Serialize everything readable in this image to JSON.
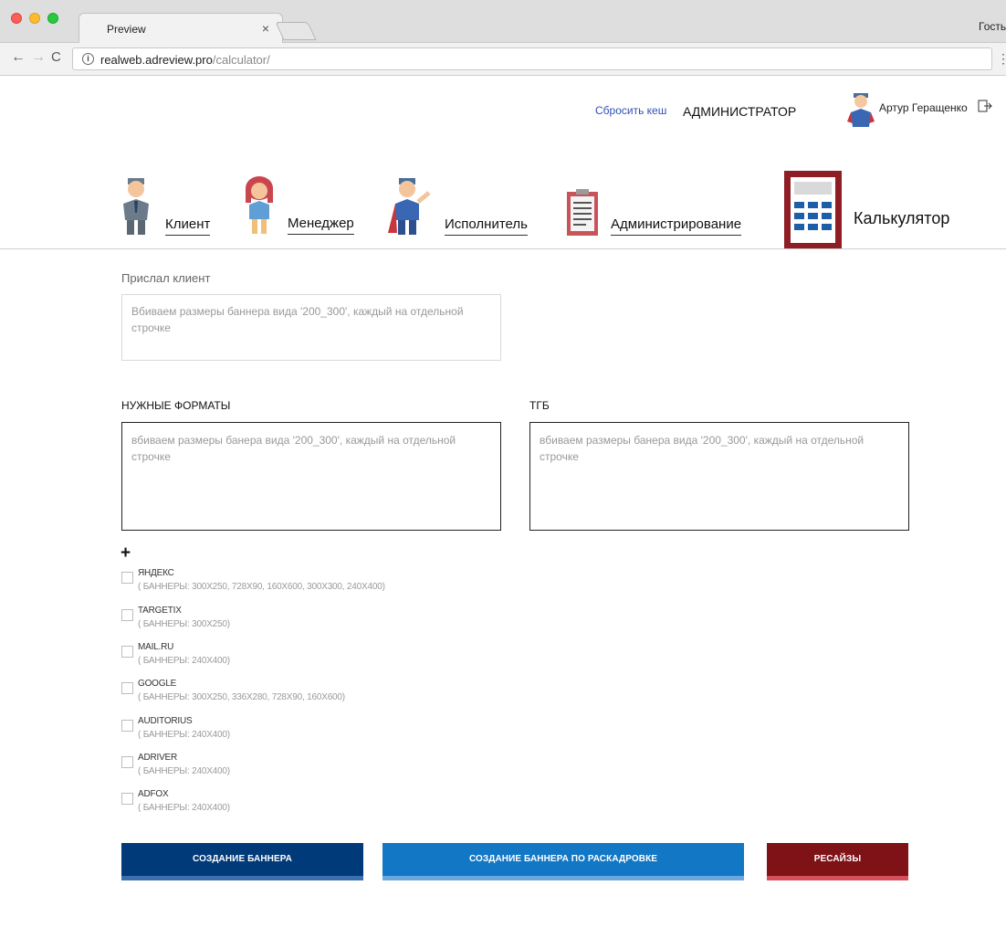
{
  "browser": {
    "tab_title": "Preview",
    "tab_close": "×",
    "guest_label": "Гость",
    "url_host": "realweb.adreview.pro",
    "url_path": "/calculator/",
    "back_glyph": "←",
    "forward_glyph": "→",
    "reload_glyph": "C",
    "menu_glyph": "⋮",
    "info_glyph": "i"
  },
  "header": {
    "reset_cache": "Сбросить кеш",
    "role": "АДМИНИСТРАТОР",
    "user_name": "Артур Геращенко"
  },
  "nav": {
    "client": "Клиент",
    "manager": "Менеджер",
    "executor": "Исполнитель",
    "admin": "Администрирование",
    "calculator": "Калькулятор"
  },
  "form": {
    "client_label": "Прислал клиент",
    "client_placeholder": "Вбиваем размеры баннера вида '200_300', каждый на отдельной строчке",
    "formats_label": "НУЖНЫЕ ФОРМАТЫ",
    "formats_placeholder": "вбиваем размеры банера вида '200_300', каждый на отдельной строчке",
    "tgb_label": "ТГБ",
    "tgb_placeholder": "вбиваем размеры банера вида '200_300', каждый на отдельной строчке",
    "add_label": "+"
  },
  "platforms": [
    {
      "name": "ЯНДЕКС",
      "sizes": "( БАННЕРЫ: 300X250, 728X90, 160X600, 300X300, 240X400)"
    },
    {
      "name": "TARGETIX",
      "sizes": "( БАННЕРЫ: 300X250)"
    },
    {
      "name": "MAIL.RU",
      "sizes": "( БАННЕРЫ: 240X400)"
    },
    {
      "name": "GOOGLE",
      "sizes": "( БАННЕРЫ: 300X250, 336X280, 728X90, 160X600)"
    },
    {
      "name": "AUDITORIUS",
      "sizes": "( БАННЕРЫ: 240X400)"
    },
    {
      "name": "ADRIVER",
      "sizes": "( БАННЕРЫ: 240X400)"
    },
    {
      "name": "ADFOX",
      "sizes": "( БАННЕРЫ: 240X400)"
    }
  ],
  "actions": {
    "create_banner": "СОЗДАНИЕ БАННЕРА",
    "create_storyboard": "СОЗДАНИЕ БАННЕРА ПО РАСКАДРОВКЕ",
    "resizes": "РЕСАЙЗЫ"
  },
  "colors": {
    "create_banner": "#003a79",
    "create_storyboard": "#1277c4",
    "resizes": "#7f1217",
    "link": "#3050b5"
  }
}
